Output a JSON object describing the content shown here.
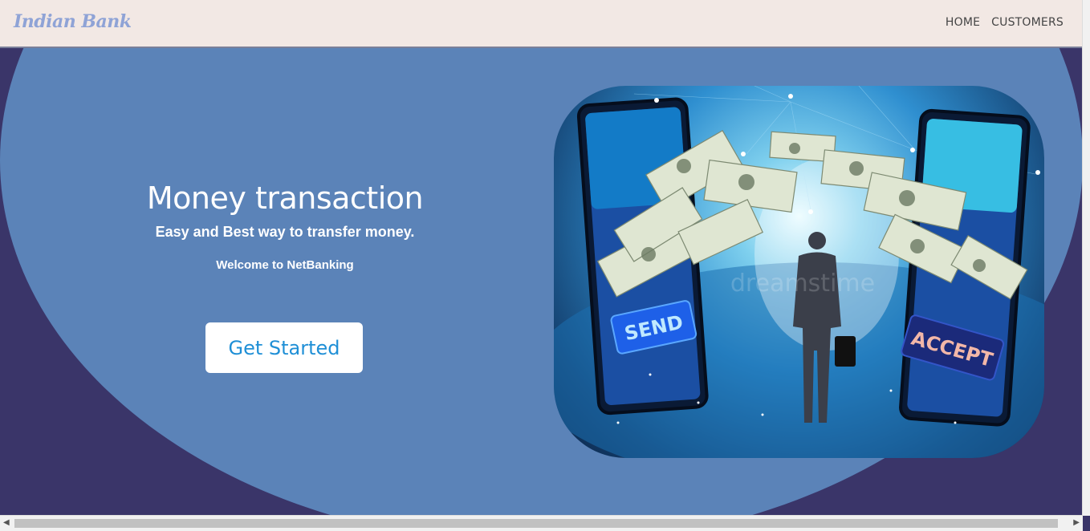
{
  "navbar": {
    "brand": "Indian Bank",
    "links": [
      {
        "label": "HOME"
      },
      {
        "label": "CUSTOMERS"
      }
    ]
  },
  "hero": {
    "title": "Money transaction",
    "subtitle": "Easy and Best way to transfer money.",
    "welcome": "Welcome to NetBanking",
    "cta_label": "Get Started",
    "image": {
      "send_label": "SEND",
      "accept_label": "ACCEPT",
      "watermark": "dreamstime"
    }
  },
  "colors": {
    "navbar_bg": "#f2e8e4",
    "brand": "#8fa3d6",
    "hero_outer": "#3a3569",
    "hero_inner": "#5b83b8",
    "cta_text": "#1f8fd6"
  }
}
